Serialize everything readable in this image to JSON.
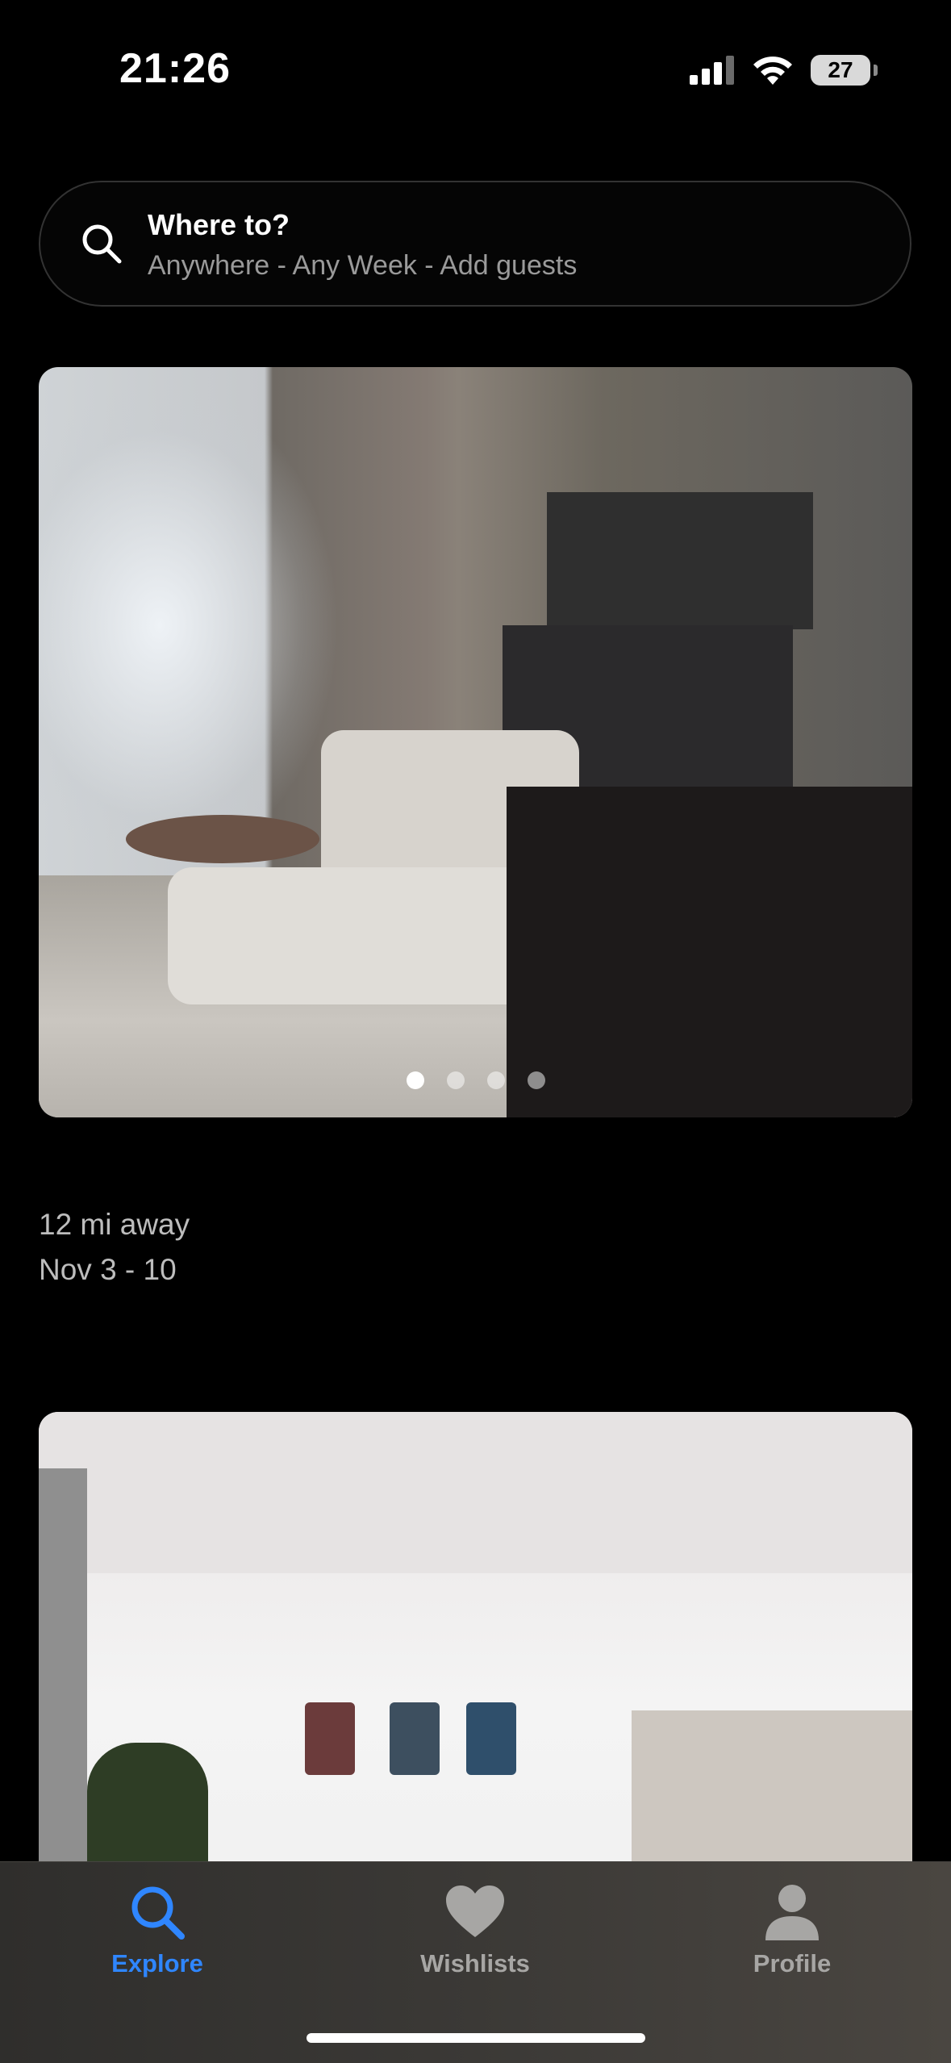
{
  "status_bar": {
    "time": "21:26",
    "battery": "27"
  },
  "search": {
    "title": "Where to?",
    "subtitle": "Anywhere - Any Week - Add guests"
  },
  "listings": [
    {
      "distance": "12 mi away",
      "dates": "Nov 3 - 10",
      "photo_count": 4,
      "active_photo": 1
    },
    {
      "distance": "",
      "dates": ""
    }
  ],
  "tab_bar": {
    "items": [
      {
        "label": "Explore",
        "icon": "search-icon",
        "active": true
      },
      {
        "label": "Wishlists",
        "icon": "heart-icon",
        "active": false
      },
      {
        "label": "Profile",
        "icon": "person-icon",
        "active": false
      }
    ]
  },
  "colors": {
    "accent": "#2f86ff",
    "background": "#000000",
    "inactive_tab": "#a7a6a4"
  }
}
